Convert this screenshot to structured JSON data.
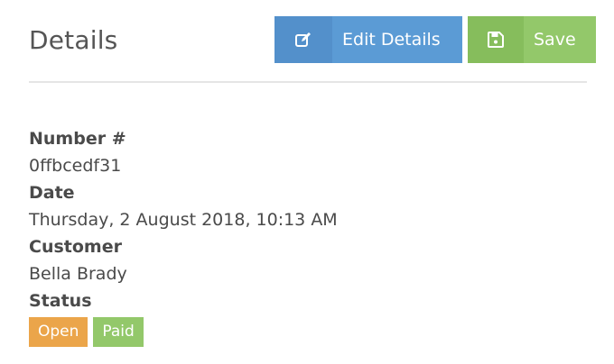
{
  "header": {
    "title": "Details",
    "edit_label": "Edit Details",
    "save_label": "Save"
  },
  "icons": {
    "edit": "edit-icon",
    "save": "floppy-disk-icon"
  },
  "fields": {
    "number_label": "Number #",
    "number_value": "0ffbcedf31",
    "date_label": "Date",
    "date_value": "Thursday, 2 August 2018, 10:13 AM",
    "customer_label": "Customer",
    "customer_value": "Bella Brady",
    "status_label": "Status"
  },
  "status_badges": [
    {
      "label": "Open",
      "color": "#eba54a"
    },
    {
      "label": "Paid",
      "color": "#93c86a"
    }
  ],
  "colors": {
    "edit_button": "#5b9bd5",
    "save_button": "#93c86a"
  }
}
